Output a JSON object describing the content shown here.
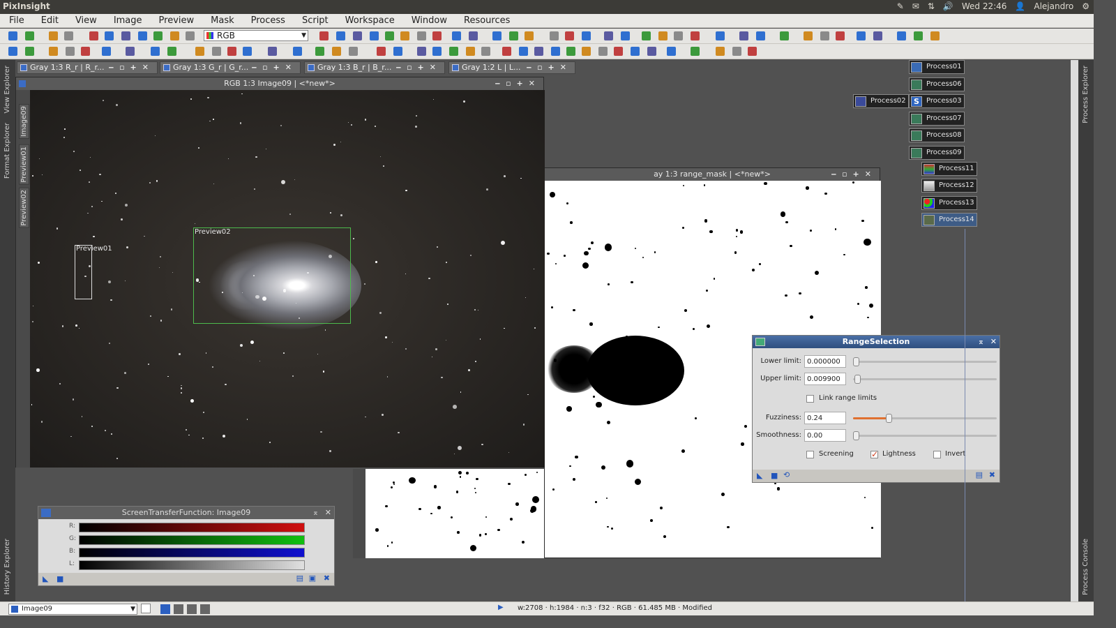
{
  "system": {
    "app_title": "PixInsight",
    "clock": "Wed 22:46",
    "user": "Alejandro"
  },
  "menu": [
    "File",
    "Edit",
    "View",
    "Image",
    "Preview",
    "Mask",
    "Process",
    "Script",
    "Workspace",
    "Window",
    "Resources"
  ],
  "toolbar": {
    "color_space_select": "RGB"
  },
  "side_panels": {
    "left": [
      "View Explorer",
      "Format Explorer",
      "History Explorer"
    ],
    "right": [
      "Process Explorer",
      "Process Console"
    ]
  },
  "tabs": [
    {
      "label": "Gray 1:3 R_r | R_r..."
    },
    {
      "label": "Gray 1:3 G_r | G_r..."
    },
    {
      "label": "Gray 1:3 B_r | B_r..."
    },
    {
      "label": "Gray 1:2 L | L..."
    }
  ],
  "image_window": {
    "title": "RGB 1:3 Image09 | <*new*>",
    "vertical_tabs": [
      "Image09",
      "Preview01",
      "Preview02"
    ],
    "previews": [
      {
        "label": "Preview01"
      },
      {
        "label": "Preview02"
      }
    ]
  },
  "mask_window": {
    "title": "ay 1:3 range_mask | <*new*>"
  },
  "range_selection": {
    "title": "RangeSelection",
    "lower_limit": {
      "label": "Lower limit:",
      "value": "0.000000",
      "level": 0.0
    },
    "upper_limit": {
      "label": "Upper limit:",
      "value": "0.009900",
      "level": 0.0099
    },
    "link_label": "Link range limits",
    "fuzziness": {
      "label": "Fuzziness:",
      "value": "0.24",
      "level": 0.24
    },
    "smoothness": {
      "label": "Smoothness:",
      "value": "0.00",
      "level": 0.0
    },
    "screening_label": "Screening",
    "lightness_label": "Lightness",
    "invert_label": "Invert",
    "link_checked": false,
    "screening_checked": false,
    "lightness_checked": true,
    "invert_checked": false
  },
  "stf": {
    "title": "ScreenTransferFunction: Image09",
    "channels": [
      "R:",
      "G:",
      "B:",
      "L:"
    ],
    "colors": {
      "R": "#d01010",
      "G": "#10c010",
      "B": "#1010d0",
      "L": "#e0e0e0"
    }
  },
  "process_icons": [
    "Process01",
    "Process06",
    "Process03",
    "Process07",
    "Process08",
    "Process09",
    "Process11",
    "Process12",
    "Process13",
    "Process14",
    "Process02"
  ],
  "status": {
    "view": "Image09",
    "info": "w:2708 · h:1984 · n:3 · f32 · RGB · 61.485 MB · Modified"
  }
}
